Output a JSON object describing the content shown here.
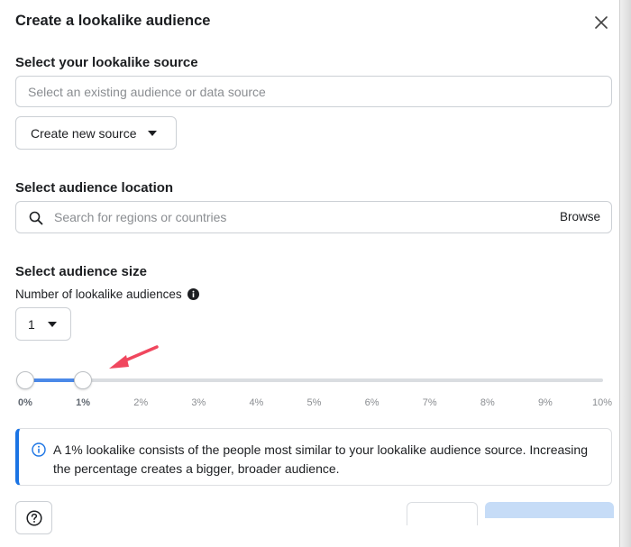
{
  "dialog": {
    "title": "Create a lookalike audience",
    "close_icon": "close-icon"
  },
  "source": {
    "heading": "Select your lookalike source",
    "placeholder": "Select an existing audience or data source",
    "create_button_label": "Create new source"
  },
  "location": {
    "heading": "Select audience location",
    "placeholder": "Search for regions or countries",
    "browse_label": "Browse",
    "search_icon": "search-icon"
  },
  "size": {
    "heading": "Select audience size",
    "count_label": "Number of lookalike audiences",
    "count_value": "1",
    "slider_range_percent": [
      0,
      1
    ],
    "tick_labels": [
      "0%",
      "1%",
      "2%",
      "3%",
      "4%",
      "5%",
      "6%",
      "7%",
      "8%",
      "9%",
      "10%"
    ]
  },
  "info": {
    "text": "A 1% lookalike consists of the people most similar to your lookalike audience source. Increasing the percentage creates a bigger, broader audience."
  },
  "colors": {
    "accent": "#1b74e4",
    "slider_fill": "#4b89e8",
    "annotation_arrow": "#f0475e"
  }
}
